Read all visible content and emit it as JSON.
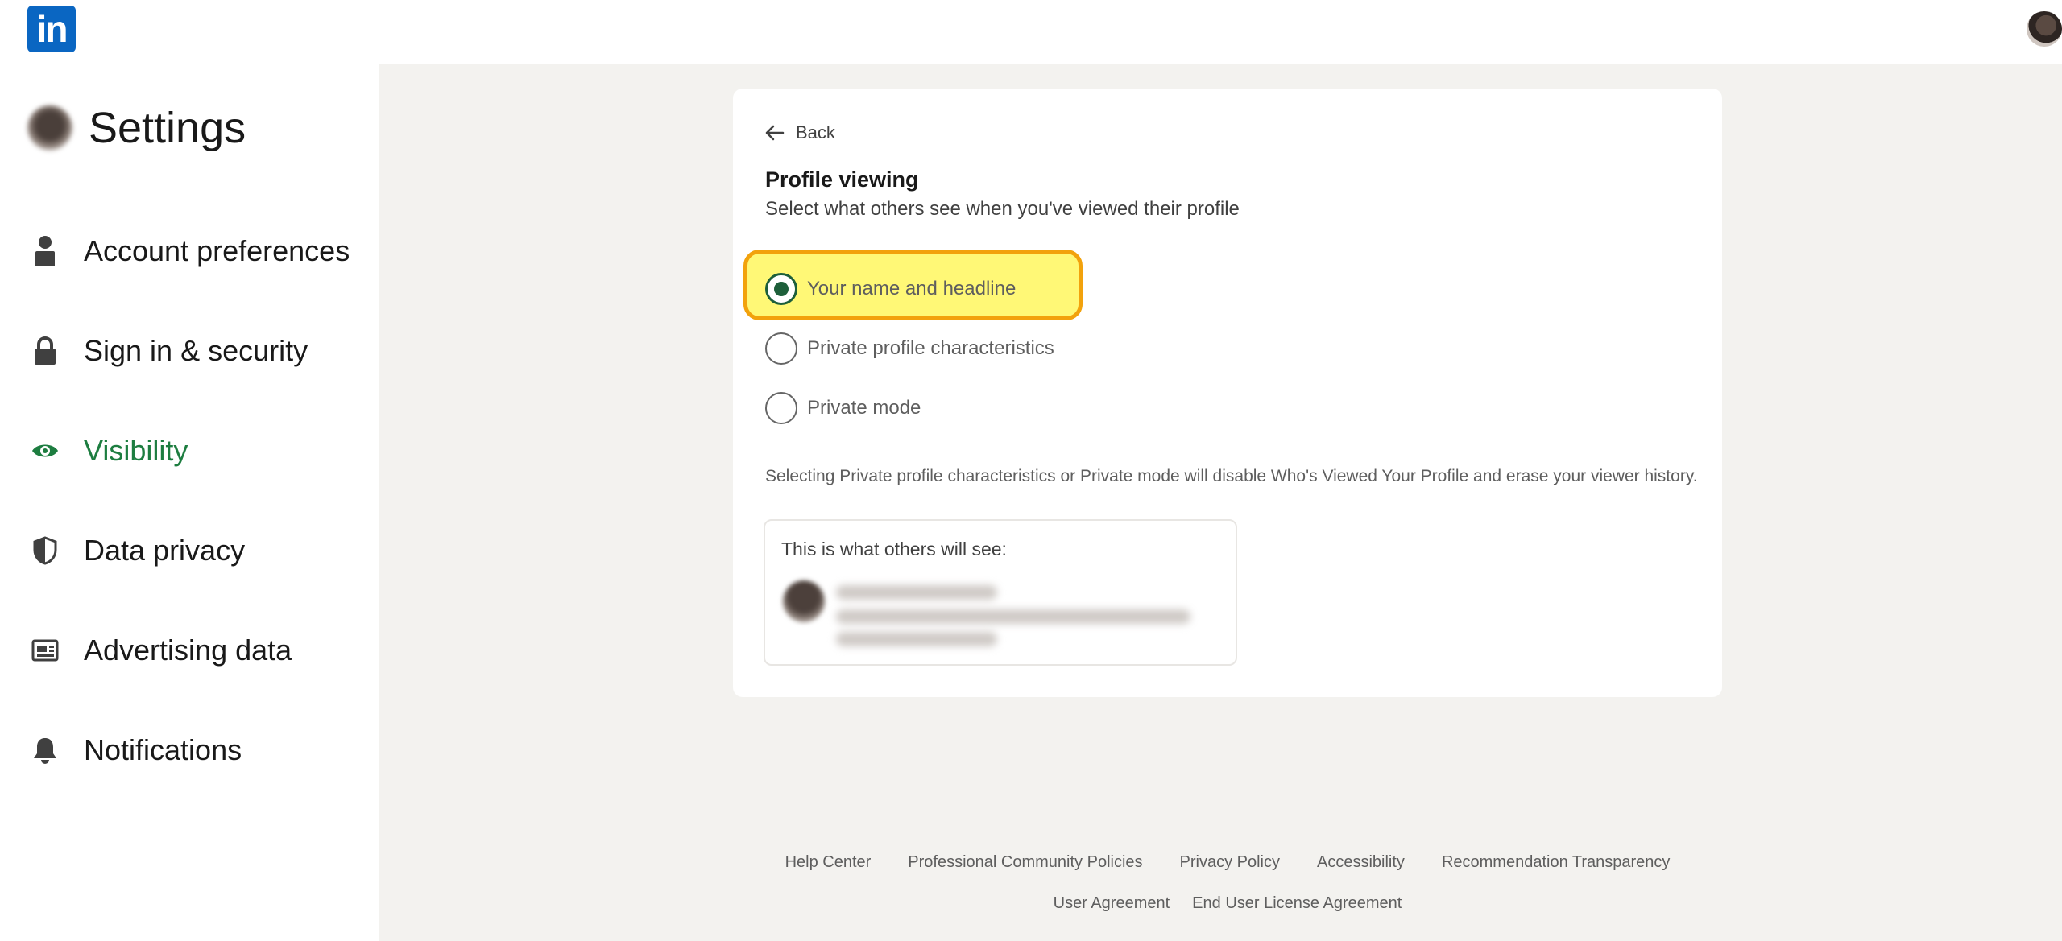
{
  "header": {
    "logo_text": "in",
    "logo_color": "#0a66c2"
  },
  "sidebar": {
    "title": "Settings",
    "accent": "#1d7d40",
    "items": [
      {
        "label": "Account preferences",
        "icon": "person-icon"
      },
      {
        "label": "Sign in & security",
        "icon": "lock-icon"
      },
      {
        "label": "Visibility",
        "icon": "eye-icon",
        "active": true
      },
      {
        "label": "Data privacy",
        "icon": "shield-icon"
      },
      {
        "label": "Advertising data",
        "icon": "ad-icon"
      },
      {
        "label": "Notifications",
        "icon": "bell-icon"
      }
    ]
  },
  "main": {
    "back_label": "Back",
    "title": "Profile viewing",
    "subtitle": "Select what others see when you've viewed their profile",
    "options": [
      {
        "label": "Your name and headline",
        "selected": true
      },
      {
        "label": "Private profile characteristics",
        "selected": false
      },
      {
        "label": "Private mode",
        "selected": false
      }
    ],
    "note": "Selecting Private profile characteristics or Private mode will disable Who's Viewed Your Profile and erase your viewer history.",
    "preview_title": "This is what others will see:"
  },
  "footer": {
    "row1": [
      "Help Center",
      "Professional Community Policies",
      "Privacy Policy",
      "Accessibility",
      "Recommendation Transparency"
    ],
    "row2": [
      "User Agreement",
      "End User License Agreement"
    ]
  }
}
